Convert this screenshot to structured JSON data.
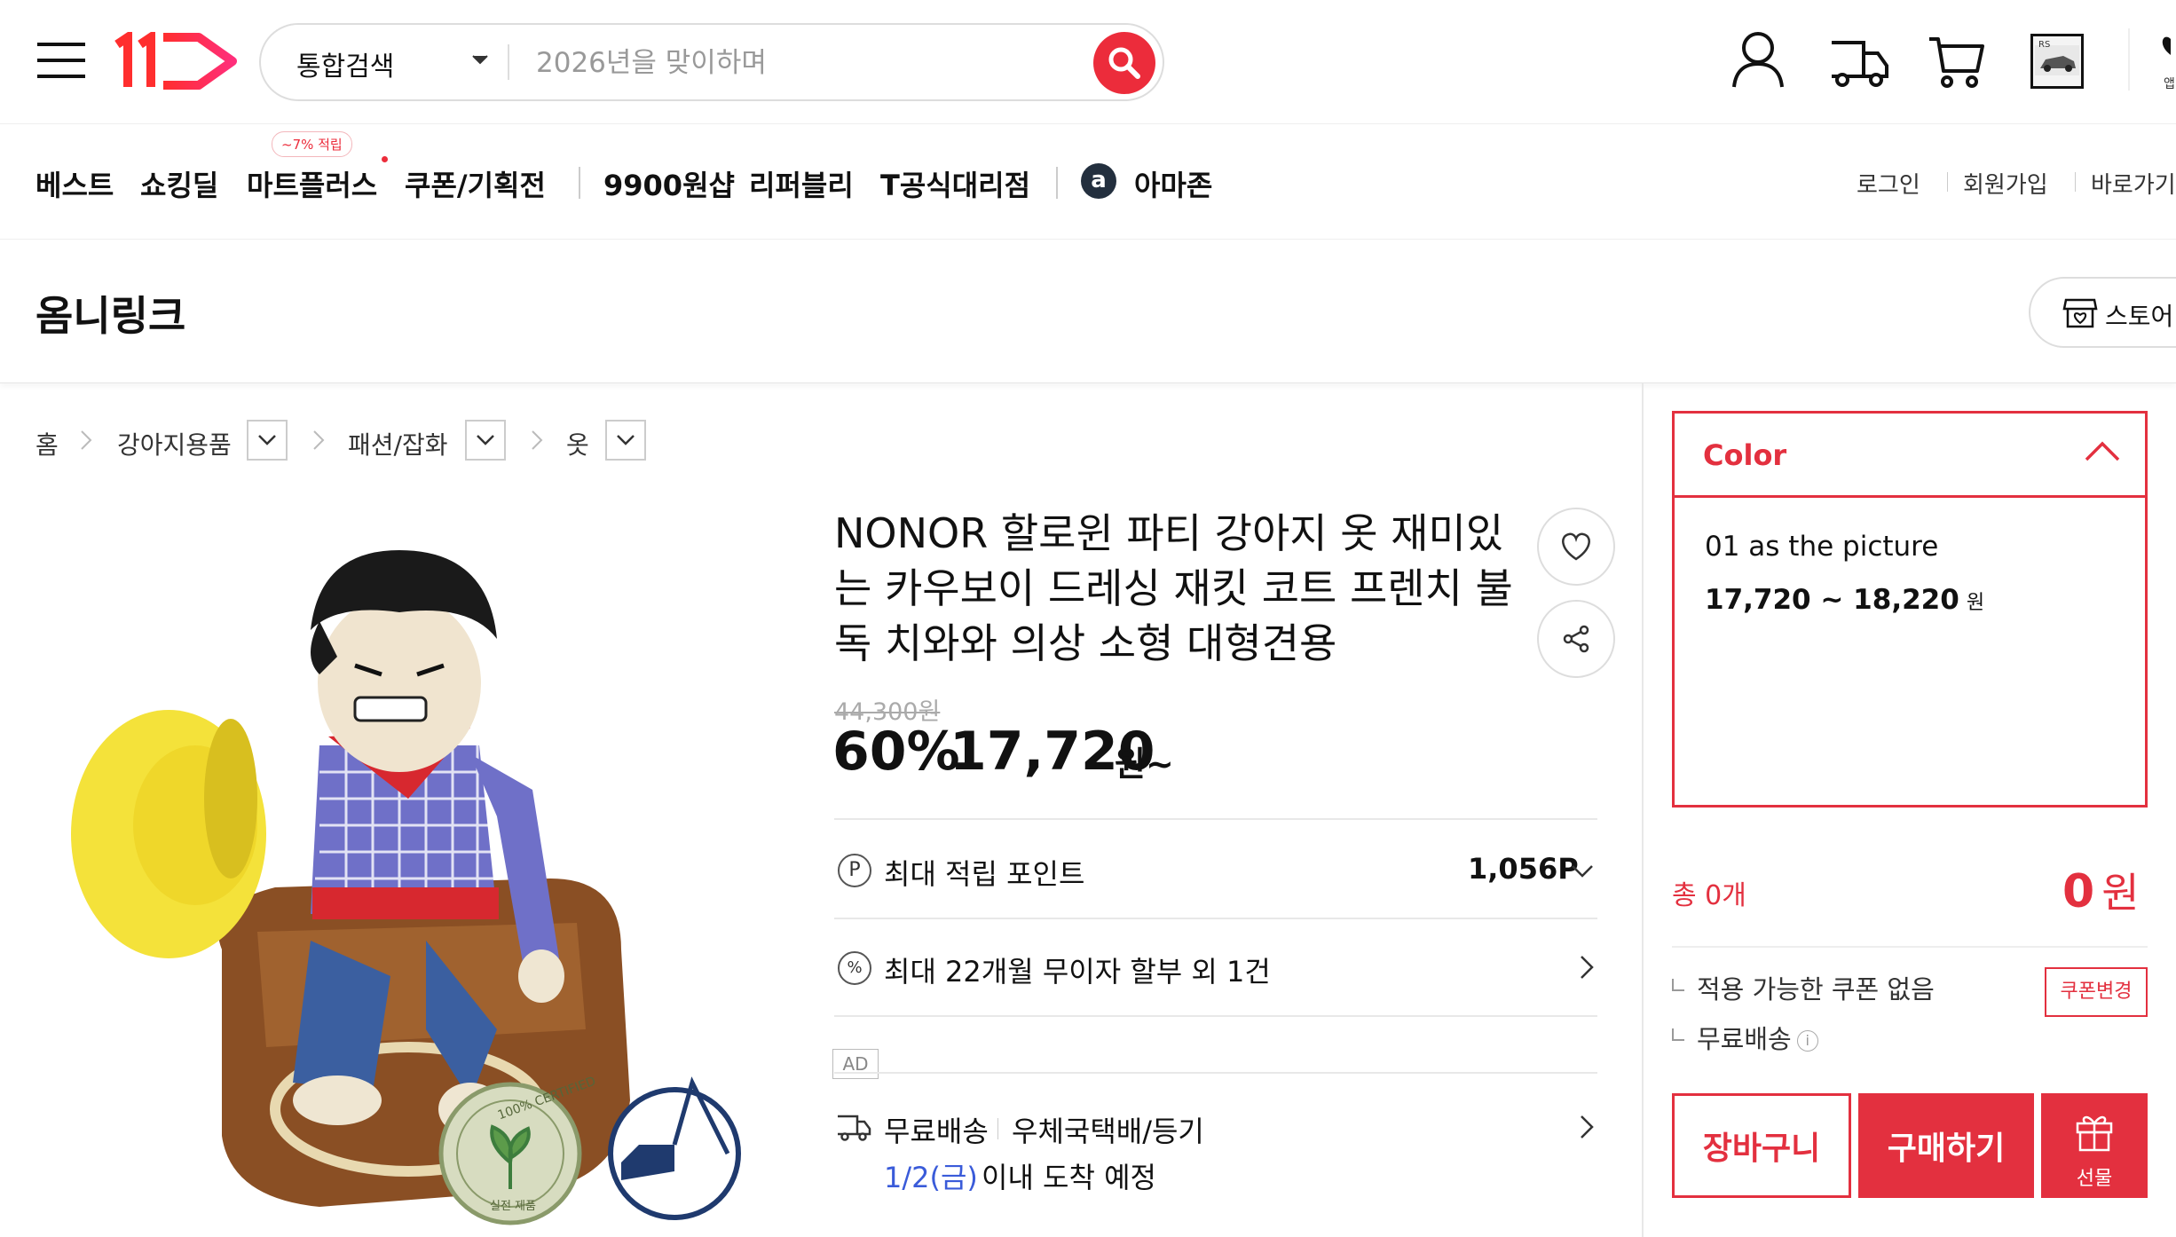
{
  "header": {
    "logo_text": "11",
    "search_category": "통합검색",
    "search_placeholder": "2026년을 맞이하며",
    "accent_color": "#ec2c3b",
    "right_edge_partial": "앱"
  },
  "nav": {
    "items": [
      "베스트",
      "쇼킹딜",
      "마트플러스",
      "쿠폰/기획전",
      "9900원샵",
      "리퍼블리",
      "T공식대리점",
      "아마존"
    ],
    "badge": "~7% 적립",
    "amazon_icon_letter": "a",
    "util_links": [
      "로그인",
      "회원가입",
      "바로가기"
    ]
  },
  "store": {
    "name": "옴니링크",
    "button_label": "스토어"
  },
  "breadcrumb": [
    "홈",
    "강아지용품",
    "패션/잡화",
    "옷"
  ],
  "product": {
    "title": "NONOR 할로윈 파티 강아지 옷 재미있는 카우보이 드레싱 재킷 코트 프렌치 불독 치와와 의상 소형 대형견용",
    "original_price": "44,300원",
    "discount": "60%",
    "price": "17,720",
    "price_unit": "원~",
    "points_label": "최대 적립 포인트",
    "points_value": "1,056P",
    "installment": "최대 22개월 무이자 할부 외 1건",
    "ad_label": "AD",
    "shipping_free": "무료배송",
    "shipping_carrier": "우체국택배/등기",
    "arrival_date": "1/2(금)",
    "arrival_text": "이내 도착 예정",
    "image_badge_text": "100% CERTIFIED",
    "image_badge_sub": "실전 제품"
  },
  "options": {
    "title": "Color",
    "item_name": "01 as the picture",
    "item_price": "17,720 ~ 18,220",
    "item_price_unit": "원"
  },
  "summary": {
    "total_label": "총 0개",
    "total_amount": "0",
    "total_unit": "원",
    "coupon_text": "적용 가능한 쿠폰 없음",
    "coupon_button": "쿠폰변경",
    "shipping_text": "무료배송",
    "info_icon": "i"
  },
  "actions": {
    "cart": "장바구니",
    "buy": "구매하기",
    "gift": "선물"
  }
}
